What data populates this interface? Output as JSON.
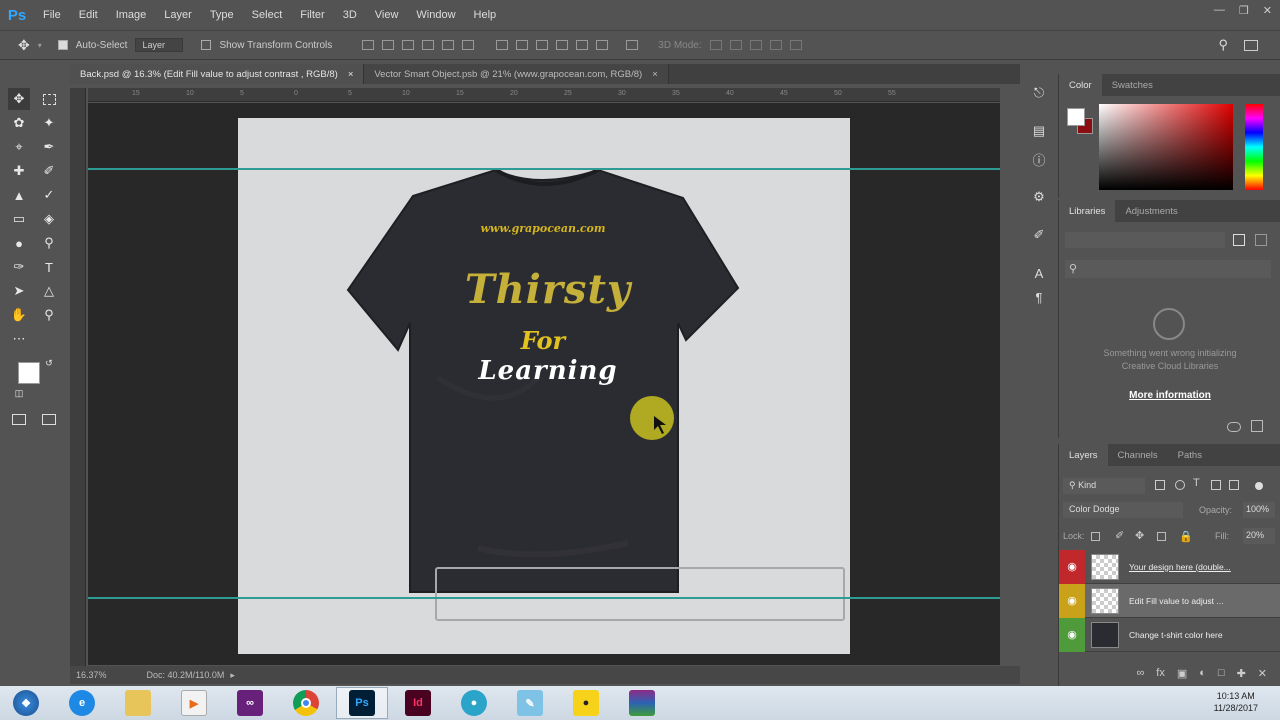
{
  "app": {
    "logo": "Ps"
  },
  "menu": [
    "File",
    "Edit",
    "Image",
    "Layer",
    "Type",
    "Select",
    "Filter",
    "3D",
    "View",
    "Window",
    "Help"
  ],
  "options": {
    "auto_select_label": "Auto-Select",
    "auto_select_value": "Layer",
    "show_transform_label": "Show Transform Controls",
    "mode_3d_label": "3D Mode:"
  },
  "tabs": [
    {
      "label": "Back.psd @ 16.3% (Edit Fill value to adjust contrast , RGB/8)",
      "close": "×",
      "active": true
    },
    {
      "label": "Vector Smart Object.psb @ 21% (www.grapocean.com, RGB/8)",
      "close": "×",
      "active": false
    }
  ],
  "ruler_ticks": [
    "15",
    "10",
    "5",
    "0",
    "5",
    "10",
    "15",
    "20",
    "25",
    "30",
    "35",
    "40",
    "45",
    "50",
    "55"
  ],
  "canvas": {
    "shirt_url": "www.grapocean.com",
    "shirt_line1": "Thirsty",
    "shirt_line2": "For",
    "shirt_line3": "Learning",
    "shirt_color": "#2b2c31",
    "gold": "#d4b51e"
  },
  "status": {
    "zoom": "16.37%",
    "doc": "Doc: 40.2M/110.0M"
  },
  "color_panel": {
    "tabs": [
      "Color",
      "Swatches"
    ],
    "fg": "#ffffff",
    "bg": "#8b0e12"
  },
  "libraries_panel": {
    "tabs": [
      "Libraries",
      "Adjustments"
    ],
    "error_line1": "Something went wrong initializing",
    "error_line2": "Creative Cloud Libraries",
    "more_info": "More information"
  },
  "layers_panel": {
    "tabs": [
      "Layers",
      "Channels",
      "Paths"
    ],
    "kind_label": "Kind",
    "blend_mode": "Color Dodge",
    "opacity_label": "Opacity:",
    "opacity_value": "100%",
    "lock_label": "Lock:",
    "fill_label": "Fill:",
    "fill_value": "20%",
    "layers": [
      {
        "name": "Your design here (double...",
        "eye_color": "#c0282c"
      },
      {
        "name": "Edit Fill value to adjust ...",
        "eye_color": "#c9a21a"
      },
      {
        "name": "Change t-shirt color here",
        "eye_color": "#4f9a3b"
      }
    ]
  },
  "taskbar": {
    "apps": [
      "start-orb",
      "internet-explorer",
      "file-explorer",
      "media-player",
      "visual-studio",
      "chrome",
      "photoshop",
      "indesign",
      "screen-recorder",
      "paint",
      "folder-app",
      "winrar"
    ],
    "time": "10:13 AM",
    "date": "11/28/2017"
  }
}
